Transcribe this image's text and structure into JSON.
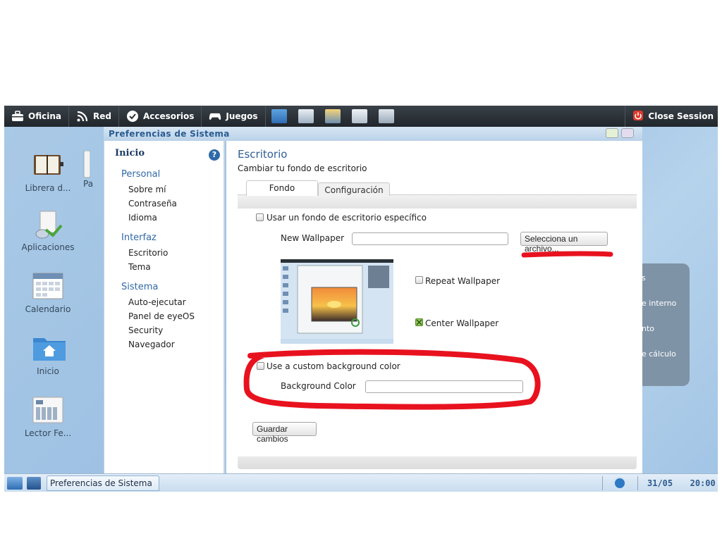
{
  "topbar": {
    "menus": [
      {
        "label": "Oficina",
        "icon": "briefcase-icon"
      },
      {
        "label": "Red",
        "icon": "rss-icon"
      },
      {
        "label": "Accesorios",
        "icon": "clock-check-icon"
      },
      {
        "label": "Juegos",
        "icon": "gamepad-icon"
      }
    ],
    "quick_icons": [
      "folder-icon",
      "document-icon",
      "image-viewer-icon",
      "contacts-icon",
      "calendar-icon"
    ],
    "close_session": "Close Session"
  },
  "desktop": {
    "icons": [
      {
        "label": "Librera d...",
        "icon": "book-icon"
      },
      {
        "label": "Pa",
        "icon": "document-icon"
      },
      {
        "label": "Aplicaciones",
        "icon": "applications-icon"
      },
      {
        "label": "Calendario",
        "icon": "calendar-icon"
      },
      {
        "label": "Inicio",
        "icon": "home-folder-icon"
      },
      {
        "label": "Lector Fe...",
        "icon": "newspaper-icon"
      }
    ],
    "right_panel": [
      "s",
      "e interno",
      "nto",
      "e cálculo"
    ]
  },
  "window": {
    "title": "Preferencias de Sistema",
    "sidebar": {
      "home": "Inicio",
      "help": "?",
      "sections": [
        {
          "title": "Personal",
          "items": [
            "Sobre mí",
            "Contraseña",
            "Idioma"
          ]
        },
        {
          "title": "Interfaz",
          "items": [
            "Escritorio",
            "Tema"
          ]
        },
        {
          "title": "Sistema",
          "items": [
            "Auto-ejecutar",
            "Panel de eyeOS",
            "Security",
            "Navegador"
          ]
        }
      ]
    },
    "main": {
      "title": "Escritorio",
      "subtitle": "Cambiar tu fondo de escritorio",
      "tabs": [
        "Fondo",
        "Configuración"
      ],
      "use_specific_bg": "Usar un fondo de escritorio específico",
      "new_wallpaper_label": "New Wallpaper",
      "new_wallpaper_value": "",
      "select_file_button": "Selecciona un archivo...",
      "repeat_wallpaper": "Repeat Wallpaper",
      "center_wallpaper": "Center Wallpaper",
      "center_wallpaper_checked": true,
      "use_custom_color": "Use a custom background color",
      "bg_color_label": "Background Color",
      "bg_color_value": "",
      "save_button": "Guardar cambios"
    }
  },
  "taskbar": {
    "task": "Preferencias de Sistema",
    "date": "31/05",
    "time": "20:00"
  },
  "colors": {
    "topbar": "#2a3137",
    "desktop": "#a9c9e6",
    "accent": "#2f69a8",
    "annotation": "#e8121f"
  }
}
